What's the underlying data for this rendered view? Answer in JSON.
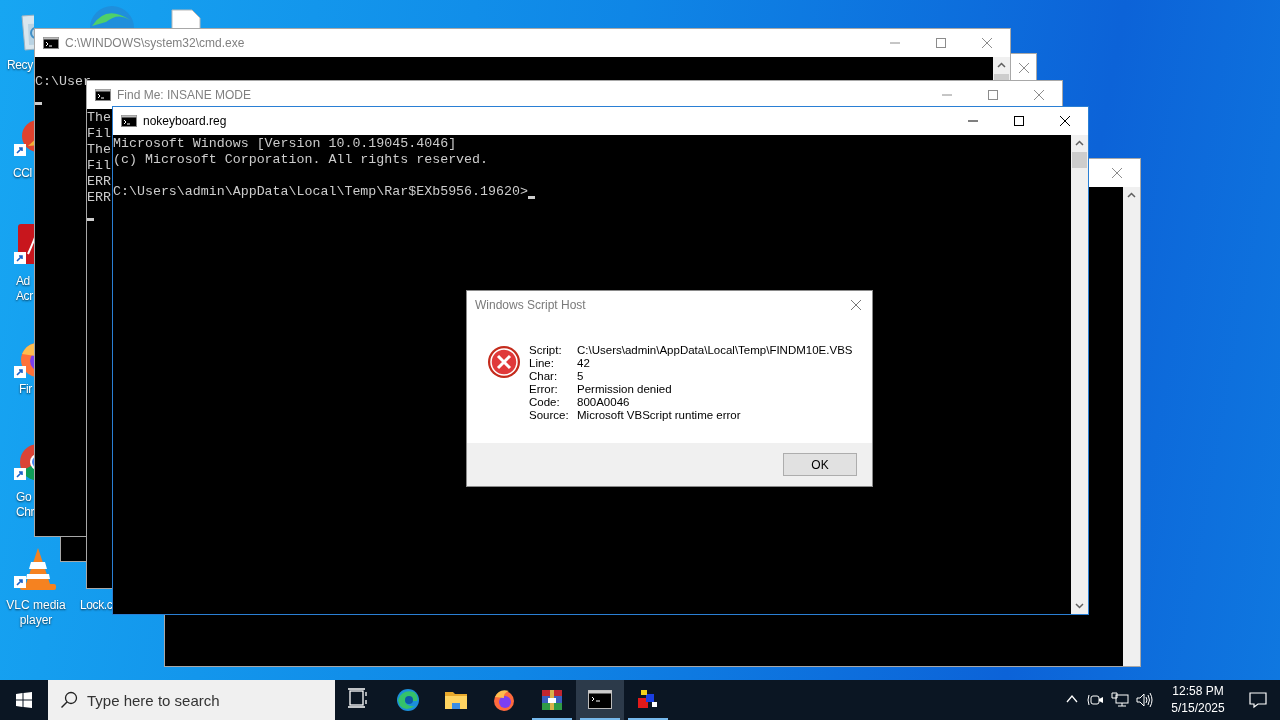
{
  "desktop_icons": [
    {
      "kind": "recycle-bin",
      "label_lines": [
        "Recy"
      ]
    },
    {
      "kind": "ccleaner",
      "label_lines": [
        "CCl"
      ]
    },
    {
      "kind": "acrobat",
      "label_lines": [
        "Ad",
        "Acr"
      ]
    },
    {
      "kind": "firefox",
      "label_lines": [
        "Fir"
      ]
    },
    {
      "kind": "chrome",
      "label_lines": [
        "Go",
        "Chr"
      ]
    },
    {
      "kind": "vlc",
      "label_lines": [
        "VLC media",
        "player"
      ]
    },
    {
      "label_lines": [
        "Lock.c"
      ]
    }
  ],
  "windows": [
    {
      "active": false
    },
    {
      "title": "C:\\WINDOWS\\system32\\cmd.exe",
      "active": false,
      "blocks": [
        [
          "C:\\User"
        ]
      ],
      "cursor_on_prompt": false
    },
    {
      "active": false
    },
    {
      "title": "Find Me: INSANE MODE",
      "active": false,
      "blocks": [
        [
          "The",
          "Fil",
          "The",
          "Fil",
          "ERR",
          "ERR"
        ]
      ],
      "cursor_on_prompt": false
    },
    {
      "title": "nokeyboard.reg",
      "active": true,
      "blocks": [
        [
          "Microsoft Windows [Version 10.0.19045.4046]",
          "(c) Microsoft Corporation. All rights reserved."
        ],
        [
          "C:\\Users\\admin\\AppData\\Local\\Temp\\Rar$EXb5956.19620>"
        ]
      ],
      "cursor_on_prompt": true
    }
  ],
  "dialog": {
    "title": "Windows Script Host",
    "rows": [
      {
        "label": "Script:",
        "value": "C:\\Users\\admin\\AppData\\Local\\Temp\\FINDM10E.VBS"
      },
      {
        "label": "Line:",
        "value": "42"
      },
      {
        "label": "Char:",
        "value": "5"
      },
      {
        "label": "Error:",
        "value": "Permission denied"
      },
      {
        "label": "Code:",
        "value": "800A0046"
      },
      {
        "label": "Source:",
        "value": "Microsoft VBScript runtime error"
      }
    ],
    "button": "OK"
  },
  "taskbar": {
    "search": {
      "placeholder": "Type here to search"
    },
    "apps": [
      {
        "kind": "task-view",
        "running": false,
        "selected": false
      },
      {
        "kind": "edge",
        "running": false,
        "selected": false
      },
      {
        "kind": "folder",
        "running": false,
        "selected": false
      },
      {
        "kind": "firefox",
        "running": false,
        "selected": false
      },
      {
        "kind": "winrar",
        "running": true,
        "selected": false
      },
      {
        "kind": "cmd",
        "running": true,
        "selected": true
      },
      {
        "kind": "blocks",
        "running": true,
        "selected": false
      }
    ],
    "clock": {
      "time": "12:58 PM",
      "date": "5/15/2025"
    }
  }
}
